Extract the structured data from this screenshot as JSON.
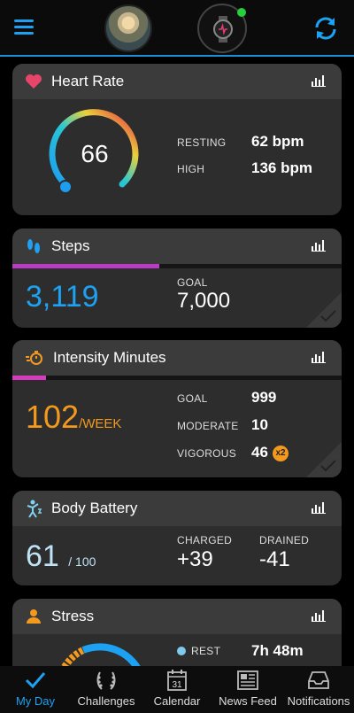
{
  "header": {
    "menu_icon": "hamburger-icon",
    "sync_icon": "sync-icon",
    "device_status_color": "#25d03a"
  },
  "heart_rate": {
    "title": "Heart Rate",
    "value": "66",
    "resting_label": "RESTING",
    "resting_value": "62 bpm",
    "high_label": "HIGH",
    "high_value": "136 bpm"
  },
  "steps": {
    "title": "Steps",
    "value": "3,119",
    "goal_label": "GOAL",
    "goal_value": "7,000",
    "progress": 0.446
  },
  "intensity": {
    "title": "Intensity Minutes",
    "value": "102",
    "unit": "/WEEK",
    "goal_label": "GOAL",
    "goal_value": "999",
    "moderate_label": "MODERATE",
    "moderate_value": "10",
    "vigorous_label": "VIGOROUS",
    "vigorous_value": "46",
    "vigorous_badge": "x2",
    "progress": 0.102
  },
  "body_battery": {
    "title": "Body Battery",
    "value": "61",
    "max": "/ 100",
    "charged_label": "CHARGED",
    "charged_value": "+39",
    "drained_label": "DRAINED",
    "drained_value": "-41"
  },
  "stress": {
    "title": "Stress",
    "rest_label": "REST",
    "rest_value": "7h 48m"
  },
  "nav": [
    {
      "label": "My Day",
      "icon": "checkmark-icon",
      "active": true
    },
    {
      "label": "Challenges",
      "icon": "laurel-icon",
      "active": false
    },
    {
      "label": "Calendar",
      "icon": "calendar-icon",
      "active": false,
      "date": "31"
    },
    {
      "label": "News Feed",
      "icon": "newspaper-icon",
      "active": false
    },
    {
      "label": "Notifications",
      "icon": "inbox-icon",
      "active": false
    }
  ],
  "colors": {
    "accent": "#1da1f2",
    "steps_value": "#1da1f2",
    "intensity_value": "#f39a1e",
    "battery_value": "#bfe3f5",
    "progress_purple": "#b83cc4",
    "intensity_progress": "#d23cbd"
  }
}
